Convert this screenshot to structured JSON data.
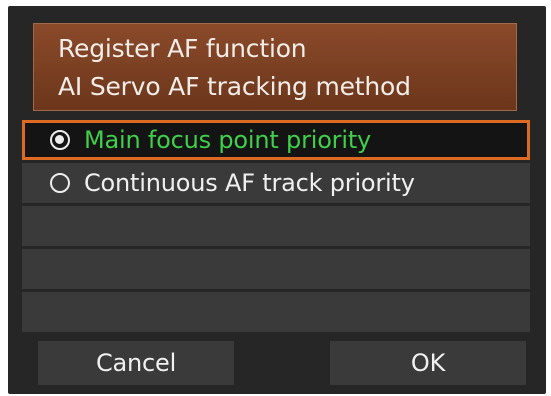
{
  "header": {
    "line1": "Register AF function",
    "line2": "AI Servo AF tracking method"
  },
  "options": [
    {
      "label": "Main focus point priority",
      "selected": true
    },
    {
      "label": "Continuous AF track priority",
      "selected": false
    }
  ],
  "buttons": {
    "cancel": "Cancel",
    "ok": "OK"
  },
  "colors": {
    "selection_border": "#dd6a22",
    "selected_text": "#3fcf4a",
    "header_bg": "#7a3f22",
    "screen_bg": "#262626"
  }
}
